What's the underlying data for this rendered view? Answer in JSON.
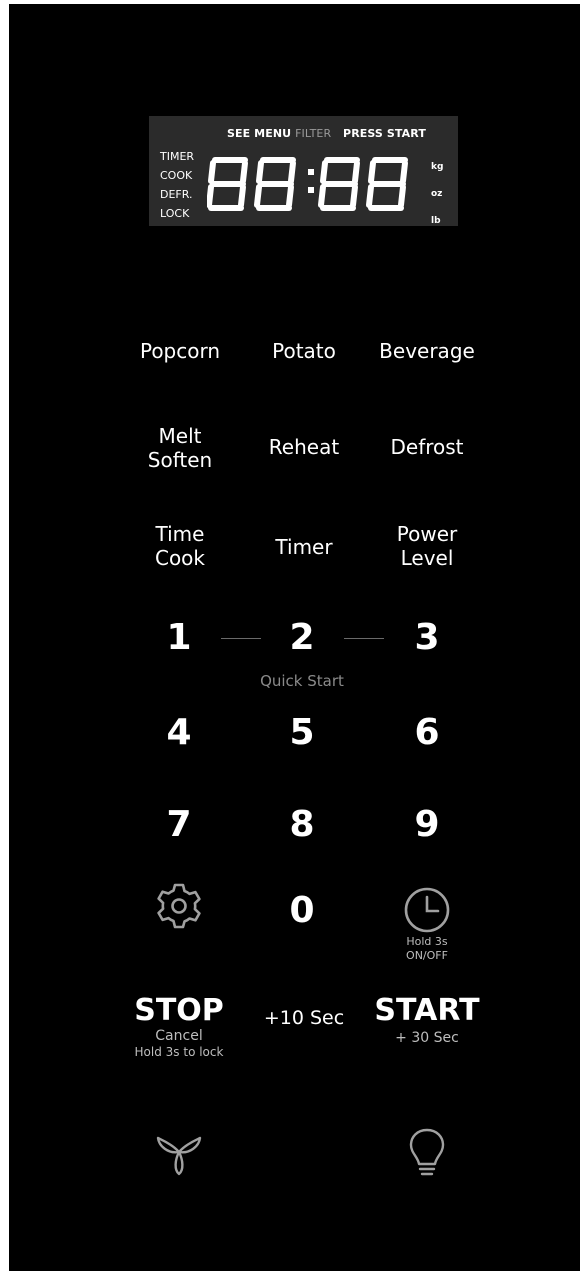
{
  "display": {
    "see_menu": "SEE MENU",
    "filter": "FILTER",
    "press_start": "PRESS START",
    "modes": [
      "TIMER",
      "COOK",
      "DEFR.",
      "LOCK"
    ],
    "units": [
      "kg",
      "oz",
      "lb"
    ],
    "readout": "88:88"
  },
  "presets": {
    "popcorn": "Popcorn",
    "potato": "Potato",
    "beverage": "Beverage",
    "melt_soften": [
      "Melt",
      "Soften"
    ],
    "reheat": "Reheat",
    "defrost": "Defrost",
    "time_cook": [
      "Time",
      "Cook"
    ],
    "timer": "Timer",
    "power_level": [
      "Power",
      "Level"
    ]
  },
  "keypad": {
    "digits": [
      "1",
      "2",
      "3",
      "4",
      "5",
      "6",
      "7",
      "8",
      "9",
      "0"
    ],
    "quick_start": "Quick Start"
  },
  "clock": {
    "hold_label": "Hold 3s",
    "onoff_label": "ON/OFF"
  },
  "stop": {
    "label": "STOP",
    "cancel": "Cancel",
    "hold_lock": "Hold 3s to lock"
  },
  "plus10": {
    "label": "+10 Sec"
  },
  "start": {
    "label": "START",
    "plus30": "+ 30 Sec"
  },
  "colors": {
    "panel": "#000000",
    "display_bg": "#2b2b2b",
    "text": "#ffffff",
    "subtext": "#bdbdbd"
  },
  "icons": [
    "settings-gear-icon",
    "clock-icon",
    "fan-icon",
    "light-bulb-icon"
  ]
}
